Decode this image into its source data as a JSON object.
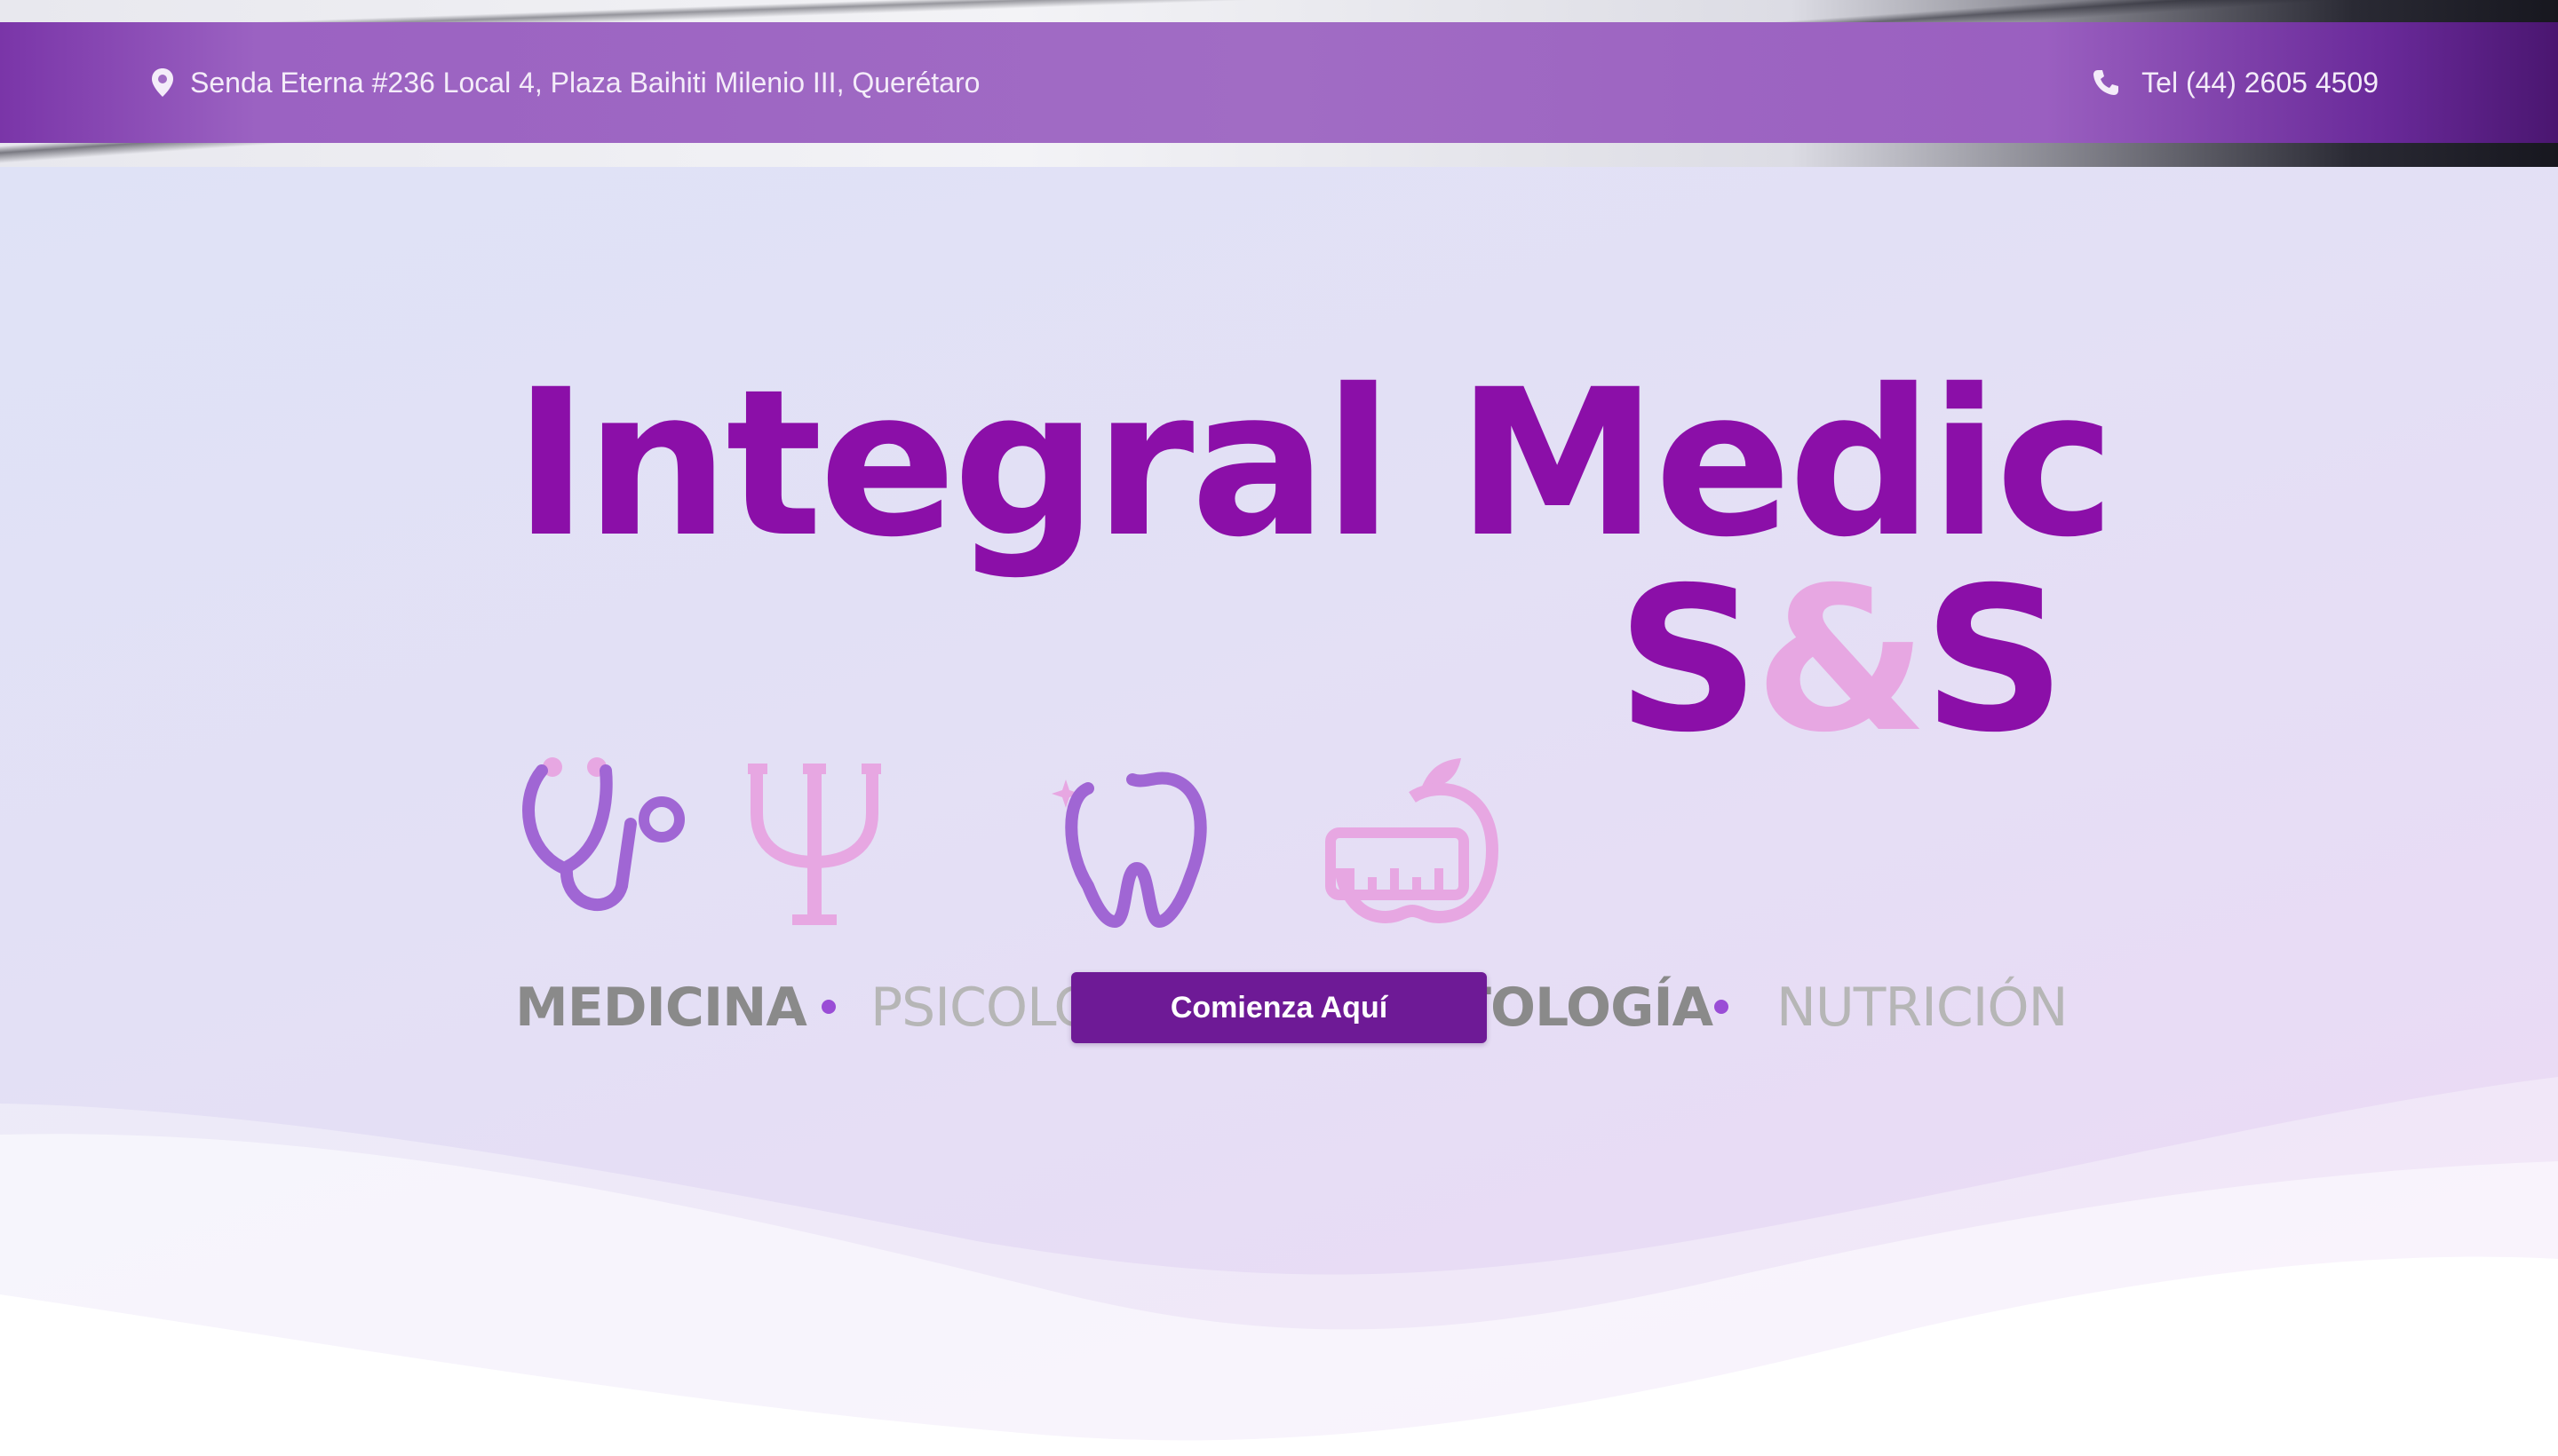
{
  "topbar": {
    "address": "Senda Eterna #236 Local 4, Plaza Baihiti Milenio III, Querétaro",
    "address_icon": "map-pin-icon",
    "phone": "Tel (44) 2605 4509",
    "phone_icon": "phone-icon"
  },
  "logo": {
    "title": "Integral Medic",
    "s1": "S",
    "amp": "&",
    "s2": "S",
    "icons": [
      "stethoscope-icon",
      "psi-icon",
      "tooth-icon",
      "apple-scale-icon"
    ],
    "services": [
      "MEDICINA",
      "PSICOLOGÍA",
      "ODONTOLOGÍA",
      "NUTRICIÓN"
    ],
    "colors": {
      "brand_purple": "#8b0fa8",
      "light_pink": "#e7a7e2",
      "icon_purple": "#a066d4",
      "gray": "#8a8a8a"
    }
  },
  "cta": {
    "label": "Comienza Aquí",
    "color": "#6e1a96"
  }
}
